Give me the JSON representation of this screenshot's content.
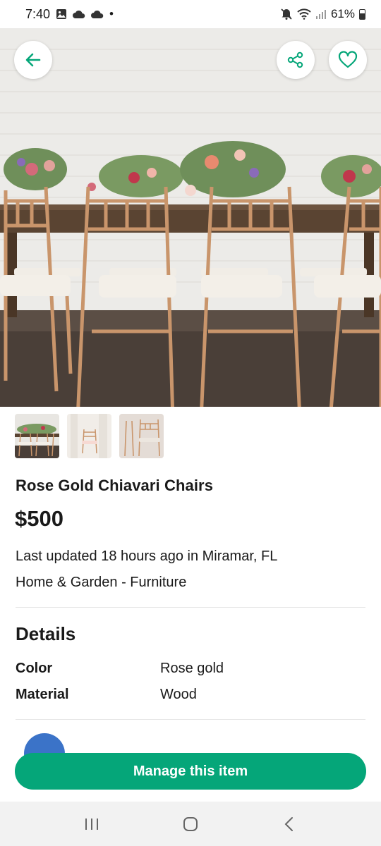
{
  "status_bar": {
    "time": "7:40",
    "dot": "•",
    "battery": "61%",
    "icons_left": [
      "image-icon",
      "cloud-sync-icon",
      "cloud-icon"
    ],
    "icons_right": [
      "mute-icon",
      "wifi-icon",
      "signal-icon",
      "battery-icon"
    ]
  },
  "listing": {
    "title": "Rose Gold Chiavari Chairs",
    "price": "$500",
    "updated": "Last updated 18 hours ago in Miramar, FL",
    "category": "Home & Garden - Furniture"
  },
  "details": {
    "heading": "Details",
    "rows": [
      {
        "label": "Color",
        "value": "Rose gold"
      },
      {
        "label": "Material",
        "value": "Wood"
      }
    ]
  },
  "actions": {
    "manage_label": "Manage this item"
  },
  "colors": {
    "accent": "#05a679",
    "chair": "#c9956b",
    "avatar": "#3b73c8"
  }
}
